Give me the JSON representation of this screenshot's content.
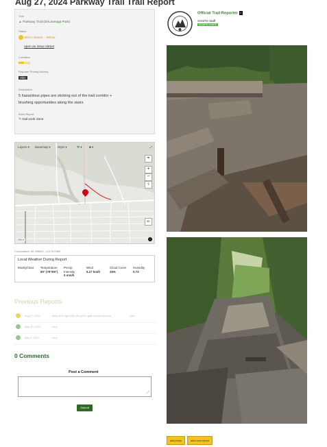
{
  "page": {
    "title": "Aug 27, 2024 Parkway Trail Trail Report"
  },
  "report": {
    "trail_label": "Trail",
    "trail_value": "Parkway Trail (DeLaveaga Park)",
    "status_label": "Status",
    "status_value": "Minor Issues - Yellow",
    "status_link": "open an issue status",
    "condition_label": "Condition",
    "condition_value": "Dry",
    "privacy_label": "Reporter Privacy Activity",
    "privacy_value": "Hike",
    "description_label": "Description",
    "description_line1": "5 hazardous pipes are sticking out of the trail corridor +",
    "description_line2": "brushing opportunities along the stairs",
    "work_label": "Work Report",
    "work_value": "trail work done"
  },
  "map": {
    "layers_label": "Layers ▾",
    "basemap_label": "Basemap ▾",
    "style_label": "Style ▾",
    "zoom_in": "+",
    "zoom_out": "−",
    "view_3d": "3D",
    "scale_label": "200 ft",
    "coordinates": "Coordinates: 36.995832, -121.997689"
  },
  "weather": {
    "title": "Local Weather During Report",
    "summary": "MostlyClear",
    "temp_label": "Temperature",
    "temp_value": "80° (79°/90°)",
    "precip_label": "Precip Intensity",
    "precip_value": "0 mm/h",
    "wind_label": "Wind",
    "wind_value": "6.27 km/h",
    "cloud_label": "Cloud Cover",
    "cloud_value": "26%",
    "humidity_label": "Humidity",
    "humidity_value": "0.73"
  },
  "previous": {
    "title": "Previous Reports",
    "items": [
      {
        "date": "Aug 27, 2024",
        "text": "fallen tree right after the green gate at the entrance",
        "link": "view",
        "color": "#f1d35a"
      },
      {
        "date": "May 30, 2023",
        "text": "",
        "link": "view",
        "color": "#9cc78a"
      },
      {
        "date": "May 6, 2023",
        "text": "",
        "link": "view",
        "color": "#9cc78a"
      }
    ]
  },
  "comments": {
    "title": "0 Comments",
    "post_label": "Post a Comment",
    "submit_label": "Submit"
  },
  "reporter": {
    "name": "Official Trail Reporter",
    "role": "SCMTS Staff",
    "org": "SCMTS STAFF"
  },
  "actions": {
    "add_photo": "add photo",
    "add_more": "add more report"
  },
  "colors": {
    "accent_green": "#2f6a23",
    "status_yellow": "#f4c21f",
    "link_green": "#3a7d2e"
  }
}
